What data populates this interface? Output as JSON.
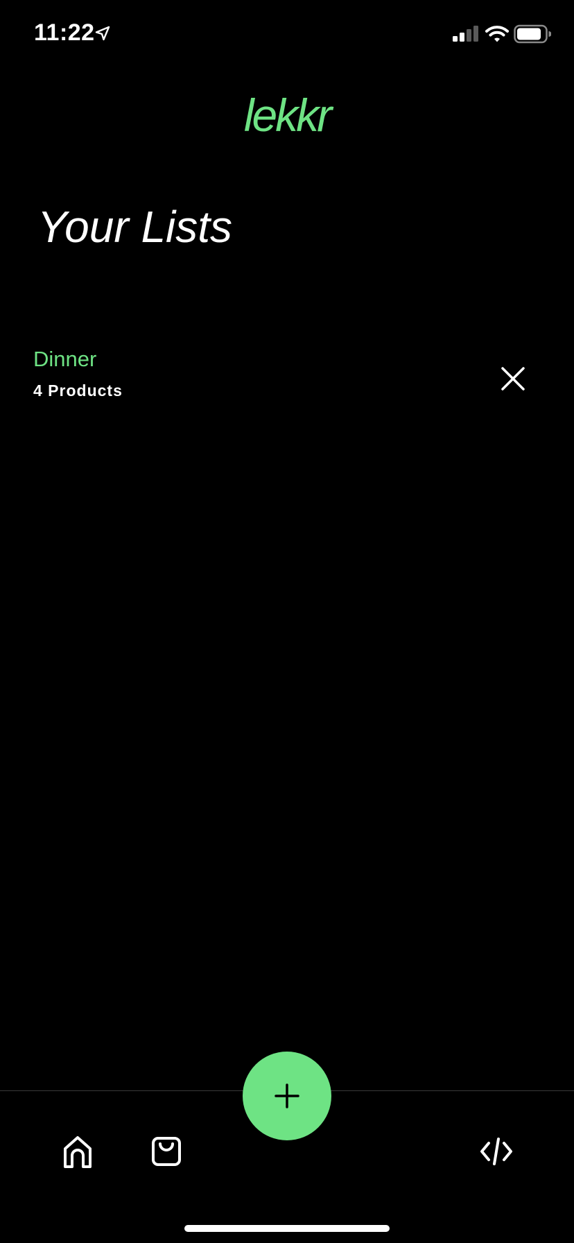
{
  "status_bar": {
    "time": "11:22"
  },
  "app": {
    "logo": "lekkr"
  },
  "page": {
    "title": "Your Lists"
  },
  "lists": [
    {
      "name": "Dinner",
      "count": "4 Products"
    }
  ],
  "tab_bar": {
    "items": [
      {
        "icon": "home-icon"
      },
      {
        "icon": "shopping-bag-icon"
      },
      {
        "icon": "code-icon"
      }
    ],
    "fab_icon": "plus-icon"
  },
  "colors": {
    "accent": "#6ee384",
    "background": "#000000",
    "text": "#ffffff"
  }
}
